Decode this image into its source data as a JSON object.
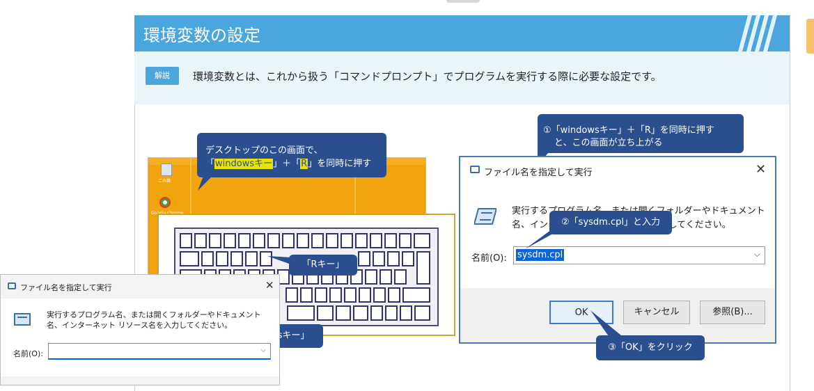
{
  "header": {
    "title": "環境変数の設定"
  },
  "explain": {
    "badge": "解説",
    "text": "環境変数とは、これから扱う「コマンドプロンプト」でプログラムを実行する際に必要な設定です。"
  },
  "desktop": {
    "icon1_label": "ごみ箱",
    "icon2_label": "Google Chrome"
  },
  "callouts": {
    "desktop": {
      "line1": "デスクトップのこの画面で、",
      "line2_pre": "「",
      "line2_win": "windowsキー",
      "line2_mid": "」＋「",
      "line2_r": "R",
      "line2_post": "」を同時に押す"
    },
    "run_top": {
      "line1": "①「windowsキー」＋「R」を同時に押す",
      "line2": "と、この画面が立ち上がる"
    },
    "sysdm": "②「sysdm.cpl」と入力",
    "r_key": "「Rキー」",
    "win_key": "wsキー」",
    "ok": "③「OK」をクリック"
  },
  "run_dialog_large": {
    "title": "ファイル名を指定して実行",
    "close": "✕",
    "description": "実行するプログラム名、または開くフォルダーやドキュメント名、インターネット リソース名を入力してください。",
    "name_label": "名前(O):",
    "name_value": "sysdm.cpl",
    "ok": "OK",
    "cancel": "キャンセル",
    "browse": "参照(B)..."
  },
  "run_dialog_small": {
    "title": "ファイル名を指定して実行",
    "close": "✕",
    "description": "実行するプログラム名、または開くフォルダーやドキュメント名、インターネット リソース名を入力してください。",
    "name_label": "名前(O):",
    "name_value": ""
  },
  "colors": {
    "header": "#4aa6dd",
    "callout": "#2b4f8e",
    "highlight": "#e8e400",
    "desktop": "#f2a40f"
  }
}
